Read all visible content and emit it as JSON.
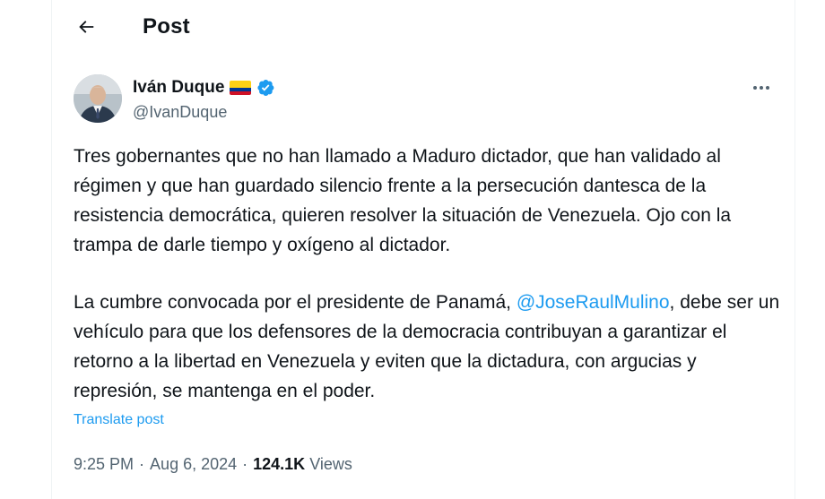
{
  "header": {
    "title": "Post",
    "back_icon": "arrow-left-icon"
  },
  "author": {
    "display_name": "Iván Duque",
    "handle": "@IvanDuque",
    "flag": "colombia-flag-icon",
    "verified_icon": "verified-badge-icon",
    "verified_color": "#1d9bf0"
  },
  "more_icon": "more-options-icon",
  "post": {
    "paragraph1": "Tres gobernantes que no han llamado a Maduro dictador, que han validado al régimen y que han guardado silencio frente a la persecución dantesca de la resistencia democrática, quieren resolver la situación de Venezuela. Ojo con la trampa de darle tiempo y oxígeno al dictador.",
    "paragraph2_before": "La cumbre convocada por el presidente de Panamá, ",
    "mention": "@JoseRaulMulino",
    "paragraph2_after": ", debe ser un vehículo para que los defensores de la democracia contribuyan a garantizar el retorno a la libertad en Venezuela y eviten que la dictadura, con argucias y represión, se mantenga en el poder."
  },
  "translate_label": "Translate post",
  "meta": {
    "time": "9:25 PM",
    "separator": "·",
    "date": "Aug 6, 2024",
    "views_count": "124.1K",
    "views_label": "Views"
  },
  "colors": {
    "text": "#0f1419",
    "secondary": "#536471",
    "link": "#1d9bf0",
    "border": "#eff3f4"
  }
}
